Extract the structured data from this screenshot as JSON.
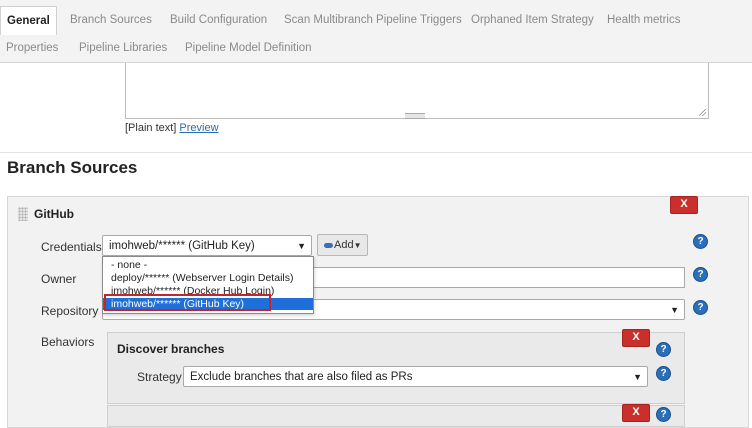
{
  "tabs": {
    "items": [
      {
        "label": "General"
      },
      {
        "label": "Branch Sources"
      },
      {
        "label": "Build Configuration"
      },
      {
        "label": "Scan Multibranch Pipeline Triggers"
      },
      {
        "label": "Orphaned Item Strategy"
      },
      {
        "label": "Health metrics"
      },
      {
        "label": "Properties"
      },
      {
        "label": "Pipeline Libraries"
      },
      {
        "label": "Pipeline Model Definition"
      }
    ]
  },
  "description": {
    "plain_text": "[Plain text]",
    "preview_link": "Preview"
  },
  "branch_sources": {
    "heading": "Branch Sources",
    "github": {
      "title": "GitHub",
      "delete_label": "X",
      "credentials_label": "Credentials",
      "credentials_value": "imohweb/****** (GitHub Key)",
      "add_label": "Add",
      "dropdown_options": [
        {
          "label": "- none -"
        },
        {
          "label": "deploy/****** (Webserver Login Details)"
        },
        {
          "label": "imohweb/****** (Docker Hub Login)"
        },
        {
          "label": "imohweb/****** (GitHub Key)"
        }
      ],
      "owner_label": "Owner",
      "owner_value": "",
      "repository_label": "Repository",
      "repository_value": "",
      "behaviors_label": "Behaviors",
      "help_glyph": "?",
      "discover_branches": {
        "title": "Discover branches",
        "delete_label": "X",
        "strategy_label": "Strategy",
        "strategy_value": "Exclude branches that are also filed as PRs"
      },
      "next_behavior": {
        "delete_label": "X"
      }
    }
  },
  "colors": {
    "delete": "#c9302c",
    "help": "#2a6fb8",
    "selected": "#1e6fd9",
    "highlight_box": "#c0262b"
  }
}
